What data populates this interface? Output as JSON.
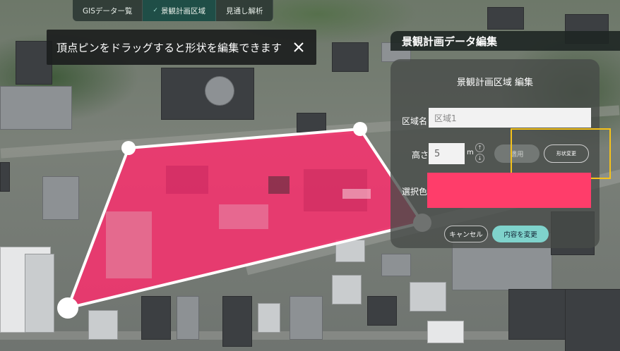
{
  "tabs": [
    {
      "label": "GISデーター覧"
    },
    {
      "label": "景観計画区域",
      "active": true
    },
    {
      "label": "見通し解析"
    }
  ],
  "hint": {
    "message": "頂点ピンをドラッグすると形状を編集できます",
    "close_icon": "close-icon"
  },
  "panel": {
    "header": "景観計画データ編集",
    "title": "景観計画区域 編集",
    "name_label": "区域名",
    "name_value": "区域1",
    "height_label": "高さ",
    "height_value": "5",
    "height_unit": "m",
    "stepper_up": "↑",
    "stepper_down": "↓",
    "apply_label": "適用",
    "shape_label": "形状変更",
    "color_label": "選択色",
    "color_value": "#ff3d6a",
    "cancel_label": "キャンセル",
    "save_label": "内容を変更"
  },
  "colors": {
    "polygon_fill": "#ff2d6e",
    "highlight": "#f5c21a",
    "accent": "#7fd3cc"
  }
}
